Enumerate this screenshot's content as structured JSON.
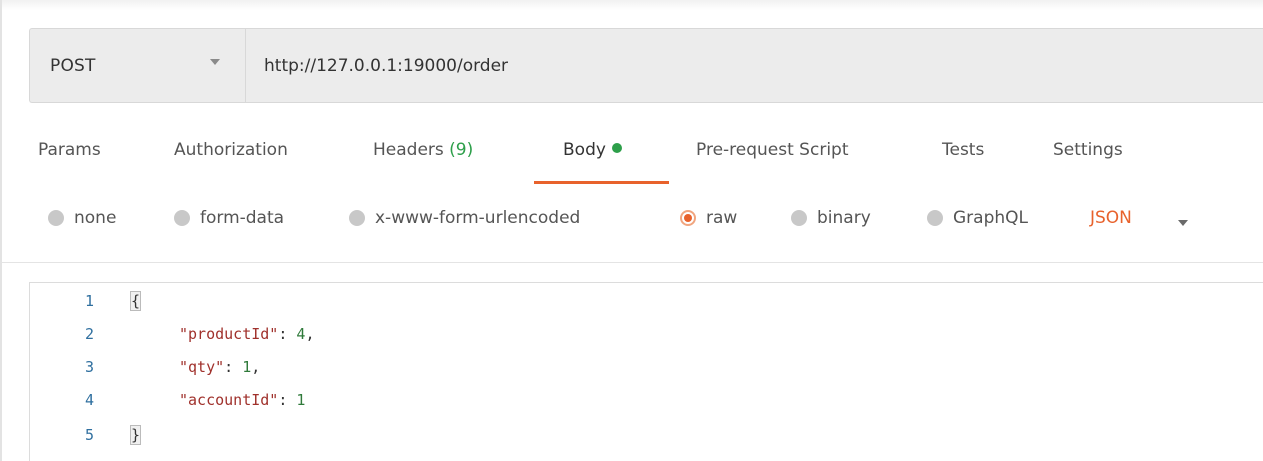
{
  "request": {
    "method": "POST",
    "url": "http://127.0.0.1:19000/order"
  },
  "tabs": [
    {
      "label": "Params"
    },
    {
      "label": "Authorization"
    },
    {
      "label": "Headers",
      "count": "(9)"
    },
    {
      "label": "Body"
    },
    {
      "label": "Pre-request Script"
    },
    {
      "label": "Tests"
    },
    {
      "label": "Settings"
    }
  ],
  "body_options": [
    {
      "label": "none"
    },
    {
      "label": "form-data"
    },
    {
      "label": "x-www-form-urlencoded"
    },
    {
      "label": "raw"
    },
    {
      "label": "binary"
    },
    {
      "label": "GraphQL"
    }
  ],
  "body_format": "JSON",
  "editor": {
    "lines": [
      {
        "num": "1",
        "open": "{"
      },
      {
        "num": "2",
        "key": "\"productId\"",
        "sep": ": ",
        "value": "4",
        "tail": ","
      },
      {
        "num": "3",
        "key": "\"qty\"",
        "sep": ": ",
        "value": "1",
        "tail": ","
      },
      {
        "num": "4",
        "key": "\"accountId\"",
        "sep": ": ",
        "value": "1",
        "tail": ""
      },
      {
        "num": "5",
        "close": "}"
      }
    ]
  },
  "colors": {
    "accent": "#e8622c",
    "success": "#2d9f4a"
  }
}
